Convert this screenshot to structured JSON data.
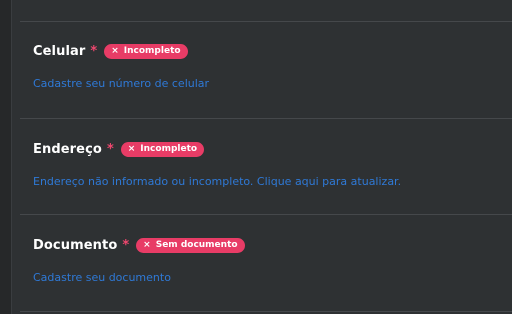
{
  "sections": [
    {
      "title": "Celular",
      "required_mark": "*",
      "badge": {
        "icon": "close-icon",
        "symbol": "×",
        "label": "Incompleto",
        "color": "#e83c66"
      },
      "link": "Cadastre seu número de celular"
    },
    {
      "title": "Endereço",
      "required_mark": "*",
      "badge": {
        "icon": "close-icon",
        "symbol": "×",
        "label": "Incompleto",
        "color": "#e83c66"
      },
      "link": "Endereço não informado ou incompleto. Clique aqui para atualizar."
    },
    {
      "title": "Documento",
      "required_mark": "*",
      "badge": {
        "icon": "close-icon",
        "symbol": "×",
        "label": "Sem documento",
        "color": "#e83c66"
      },
      "link": "Cadastre seu documento"
    }
  ],
  "colors": {
    "background": "#2e3133",
    "title": "#ffffff",
    "required": "#f0476f",
    "link": "#2f79d6",
    "divider": "#45484b"
  }
}
